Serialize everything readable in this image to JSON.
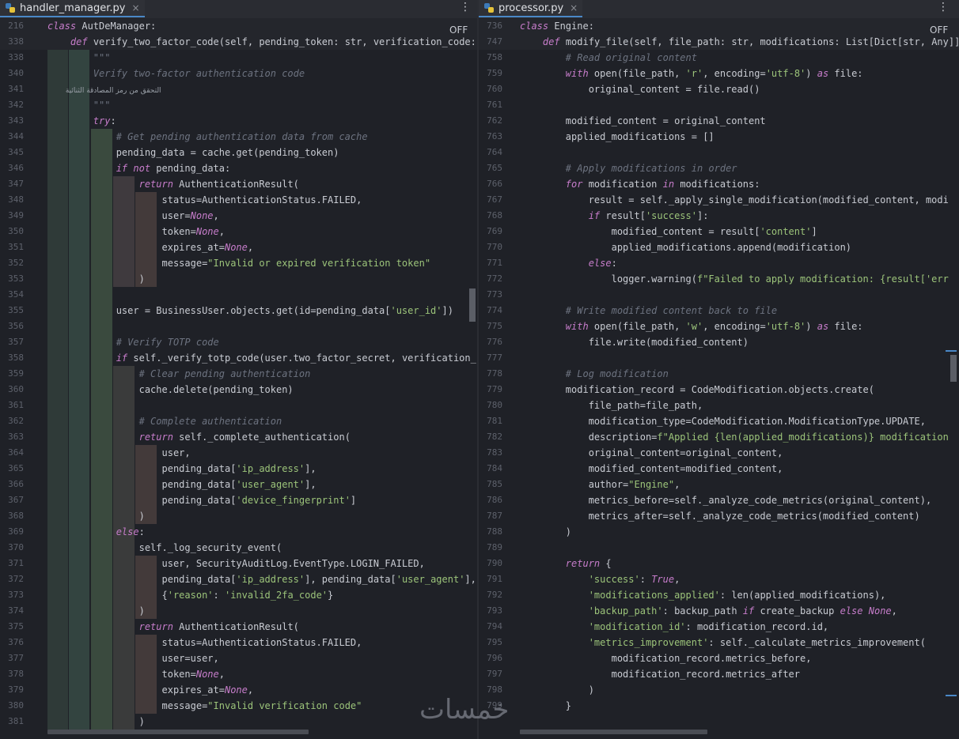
{
  "tabs": [
    {
      "name": "handler_manager.py",
      "close": "×"
    },
    {
      "name": "processor.py",
      "close": "×"
    }
  ],
  "kebab": "⋮",
  "off_label": "OFF",
  "watermark": "خمسات",
  "left": {
    "sticky": [
      {
        "n": "216",
        "t": "class AutDeManager:"
      },
      {
        "n": "338",
        "t": "    def verify_two_factor_code(self, pending_token: str, verification_code: st"
      }
    ],
    "lines": [
      {
        "n": "338",
        "t": "        \"\"\""
      },
      {
        "n": "340",
        "t": "        Verify two-factor authentication code"
      },
      {
        "n": "341",
        "t": "        التحقق من رمز المصادقة الثنائية"
      },
      {
        "n": "342",
        "t": "        \"\"\""
      },
      {
        "n": "343",
        "t": "        try:"
      },
      {
        "n": "344",
        "t": "            # Get pending authentication data from cache"
      },
      {
        "n": "345",
        "t": "            pending_data = cache.get(pending_token)"
      },
      {
        "n": "346",
        "t": "            if not pending_data:"
      },
      {
        "n": "347",
        "t": "                return AuthenticationResult("
      },
      {
        "n": "348",
        "t": "                    status=AuthenticationStatus.FAILED,"
      },
      {
        "n": "349",
        "t": "                    user=None,"
      },
      {
        "n": "350",
        "t": "                    token=None,"
      },
      {
        "n": "351",
        "t": "                    expires_at=None,"
      },
      {
        "n": "352",
        "t": "                    message=\"Invalid or expired verification token\""
      },
      {
        "n": "353",
        "t": "                )"
      },
      {
        "n": "354",
        "t": ""
      },
      {
        "n": "355",
        "t": "            user = BusinessUser.objects.get(id=pending_data['user_id'])"
      },
      {
        "n": "356",
        "t": ""
      },
      {
        "n": "357",
        "t": "            # Verify TOTP code"
      },
      {
        "n": "358",
        "t": "            if self._verify_totp_code(user.two_factor_secret, verification_cod"
      },
      {
        "n": "359",
        "t": "                # Clear pending authentication"
      },
      {
        "n": "360",
        "t": "                cache.delete(pending_token)"
      },
      {
        "n": "361",
        "t": ""
      },
      {
        "n": "362",
        "t": "                # Complete authentication"
      },
      {
        "n": "363",
        "t": "                return self._complete_authentication("
      },
      {
        "n": "364",
        "t": "                    user,"
      },
      {
        "n": "365",
        "t": "                    pending_data['ip_address'],"
      },
      {
        "n": "366",
        "t": "                    pending_data['user_agent'],"
      },
      {
        "n": "367",
        "t": "                    pending_data['device_fingerprint']"
      },
      {
        "n": "368",
        "t": "                )"
      },
      {
        "n": "369",
        "t": "            else:"
      },
      {
        "n": "370",
        "t": "                self._log_security_event("
      },
      {
        "n": "371",
        "t": "                    user, SecurityAuditLog.EventType.LOGIN_FAILED,"
      },
      {
        "n": "372",
        "t": "                    pending_data['ip_address'], pending_data['user_agent'],"
      },
      {
        "n": "373",
        "t": "                    {'reason': 'invalid_2fa_code'}"
      },
      {
        "n": "374",
        "t": "                )"
      },
      {
        "n": "375",
        "t": "                return AuthenticationResult("
      },
      {
        "n": "376",
        "t": "                    status=AuthenticationStatus.FAILED,"
      },
      {
        "n": "377",
        "t": "                    user=user,"
      },
      {
        "n": "378",
        "t": "                    token=None,"
      },
      {
        "n": "379",
        "t": "                    expires_at=None,"
      },
      {
        "n": "380",
        "t": "                    message=\"Invalid verification code\""
      },
      {
        "n": "381",
        "t": "                )"
      }
    ]
  },
  "right": {
    "sticky": [
      {
        "n": "736",
        "t": "class Engine:"
      },
      {
        "n": "747",
        "t": "    def modify_file(self, file_path: str, modifications: List[Dict[str, Any]],"
      }
    ],
    "lines": [
      {
        "n": "758",
        "t": "        # Read original content"
      },
      {
        "n": "759",
        "t": "        with open(file_path, 'r', encoding='utf-8') as file:"
      },
      {
        "n": "760",
        "t": "            original_content = file.read()"
      },
      {
        "n": "761",
        "t": ""
      },
      {
        "n": "762",
        "t": "        modified_content = original_content"
      },
      {
        "n": "763",
        "t": "        applied_modifications = []"
      },
      {
        "n": "764",
        "t": ""
      },
      {
        "n": "765",
        "t": "        # Apply modifications in order"
      },
      {
        "n": "766",
        "t": "        for modification in modifications:"
      },
      {
        "n": "767",
        "t": "            result = self._apply_single_modification(modified_content, modi"
      },
      {
        "n": "768",
        "t": "            if result['success']:"
      },
      {
        "n": "769",
        "t": "                modified_content = result['content']"
      },
      {
        "n": "770",
        "t": "                applied_modifications.append(modification)"
      },
      {
        "n": "771",
        "t": "            else:"
      },
      {
        "n": "772",
        "t": "                logger.warning(f\"Failed to apply modification: {result['err"
      },
      {
        "n": "773",
        "t": ""
      },
      {
        "n": "774",
        "t": "        # Write modified content back to file"
      },
      {
        "n": "775",
        "t": "        with open(file_path, 'w', encoding='utf-8') as file:"
      },
      {
        "n": "776",
        "t": "            file.write(modified_content)"
      },
      {
        "n": "777",
        "t": ""
      },
      {
        "n": "778",
        "t": "        # Log modification"
      },
      {
        "n": "779",
        "t": "        modification_record = CodeModification.objects.create("
      },
      {
        "n": "780",
        "t": "            file_path=file_path,"
      },
      {
        "n": "781",
        "t": "            modification_type=CodeModification.ModificationType.UPDATE,"
      },
      {
        "n": "782",
        "t": "            description=f\"Applied {len(applied_modifications)} modification"
      },
      {
        "n": "783",
        "t": "            original_content=original_content,"
      },
      {
        "n": "784",
        "t": "            modified_content=modified_content,"
      },
      {
        "n": "785",
        "t": "            author=\"Engine\","
      },
      {
        "n": "786",
        "t": "            metrics_before=self._analyze_code_metrics(original_content),"
      },
      {
        "n": "787",
        "t": "            metrics_after=self._analyze_code_metrics(modified_content)"
      },
      {
        "n": "788",
        "t": "        )"
      },
      {
        "n": "789",
        "t": ""
      },
      {
        "n": "790",
        "t": "        return {"
      },
      {
        "n": "791",
        "t": "            'success': True,"
      },
      {
        "n": "792",
        "t": "            'modifications_applied': len(applied_modifications),"
      },
      {
        "n": "793",
        "t": "            'backup_path': backup_path if create_backup else None,"
      },
      {
        "n": "794",
        "t": "            'modification_id': modification_record.id,"
      },
      {
        "n": "795",
        "t": "            'metrics_improvement': self._calculate_metrics_improvement("
      },
      {
        "n": "796",
        "t": "                modification_record.metrics_before,"
      },
      {
        "n": "797",
        "t": "                modification_record.metrics_after"
      },
      {
        "n": "798",
        "t": "            )"
      },
      {
        "n": "799",
        "t": "        }"
      }
    ]
  }
}
